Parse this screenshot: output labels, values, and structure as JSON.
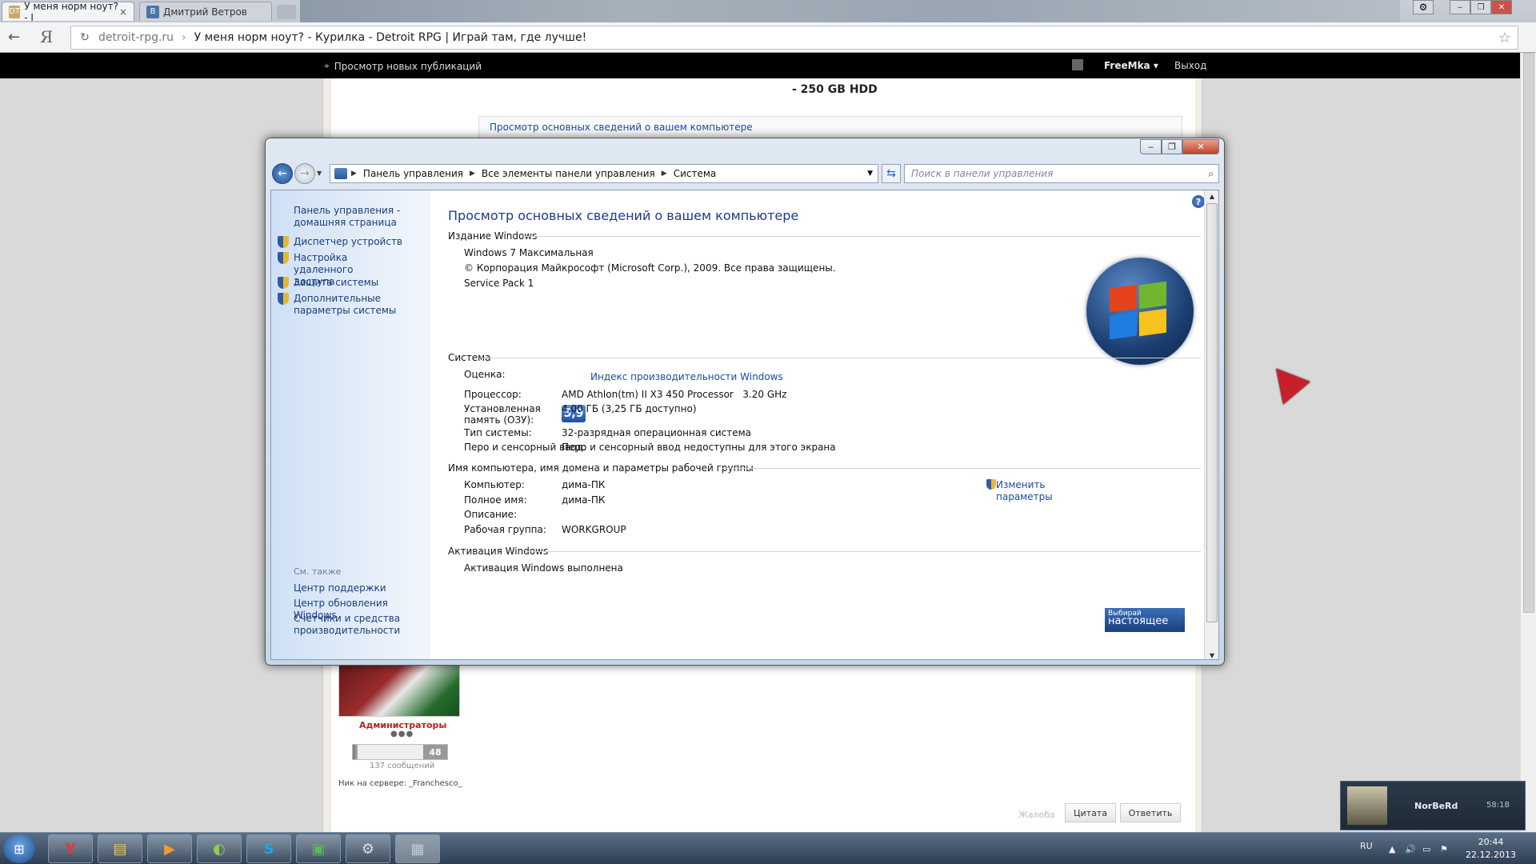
{
  "browser": {
    "tabs": [
      {
        "label": "У меня норм ноут? - I",
        "icon": "DT",
        "active": true
      },
      {
        "label": "Дмитрий Ветров",
        "icon": "B",
        "active": false
      }
    ],
    "url_host": "detroit-rpg.ru",
    "page_title": "У меня норм ноут? - Курилка - Detroit RPG | Играй там, где лучше!"
  },
  "site": {
    "new_publications": "Просмотр новых публикаций",
    "username": "FreeMka",
    "logout": "Выход",
    "post_text": "- 250 GB HDD",
    "embedded_link": "Просмотр основных сведений о вашем компьютере",
    "group": "Администраторы",
    "rep_value": "48",
    "messages": "137 сообщений",
    "nick_on_server": "Ник на сервере: _Franchesco_",
    "complaint": "Жалоба",
    "quote_btn": "Цитата",
    "reply_btn": "Ответить"
  },
  "explorer": {
    "address": [
      "Панель управления",
      "Все элементы панели управления",
      "Система"
    ],
    "search_placeholder": "Поиск в панели управления",
    "left_pane": {
      "home": "Панель управления - домашняя страница",
      "links": [
        "Диспетчер устройств",
        "Настройка удаленного доступа",
        "Защита системы",
        "Дополнительные параметры системы"
      ],
      "see_also": "См. также",
      "also_links": [
        "Центр поддержки",
        "Центр обновления Windows",
        "Счетчики и средства производительности"
      ]
    },
    "title": "Просмотр основных сведений о вашем компьютере",
    "edition_header": "Издание Windows",
    "edition": "Windows 7 Максимальная",
    "copyright": "© Корпорация Майкрософт (Microsoft Corp.), 2009. Все права защищены.",
    "service_pack": "Service Pack 1",
    "system_header": "Система",
    "rating_label": "Оценка:",
    "rating_value": "5,9",
    "rating_link": "Индекс производительности Windows",
    "cpu_label": "Процессор:",
    "cpu_value": "AMD Athlon(tm) II X3 450 Processor   3.20 GHz",
    "ram_label": "Установленная память (ОЗУ):",
    "ram_value": "4,00 ГБ (3,25 ГБ доступно)",
    "type_label": "Тип системы:",
    "type_value": "32-разрядная операционная система",
    "pen_label": "Перо и сенсорный ввод:",
    "pen_value": "Перо и сенсорный ввод недоступны для этого экрана",
    "computer_header": "Имя компьютера, имя домена и параметры рабочей группы",
    "comp_label": "Компьютер:",
    "comp_value": "дима-ПК",
    "full_label": "Полное имя:",
    "full_value": "дима-ПК",
    "desc_label": "Описание:",
    "wg_label": "Рабочая группа:",
    "wg_value": "WORKGROUP",
    "change_link": "Изменить параметры",
    "activation_header": "Активация Windows",
    "activation_status": "Активация Windows выполнена",
    "genuine_top": "Выбирай",
    "genuine_main": "настоящее"
  },
  "notification": {
    "name": "NorBeRd",
    "time": "58:18"
  },
  "taskbar": {
    "lang": "RU",
    "time": "20:44",
    "date": "22.12.2013"
  }
}
